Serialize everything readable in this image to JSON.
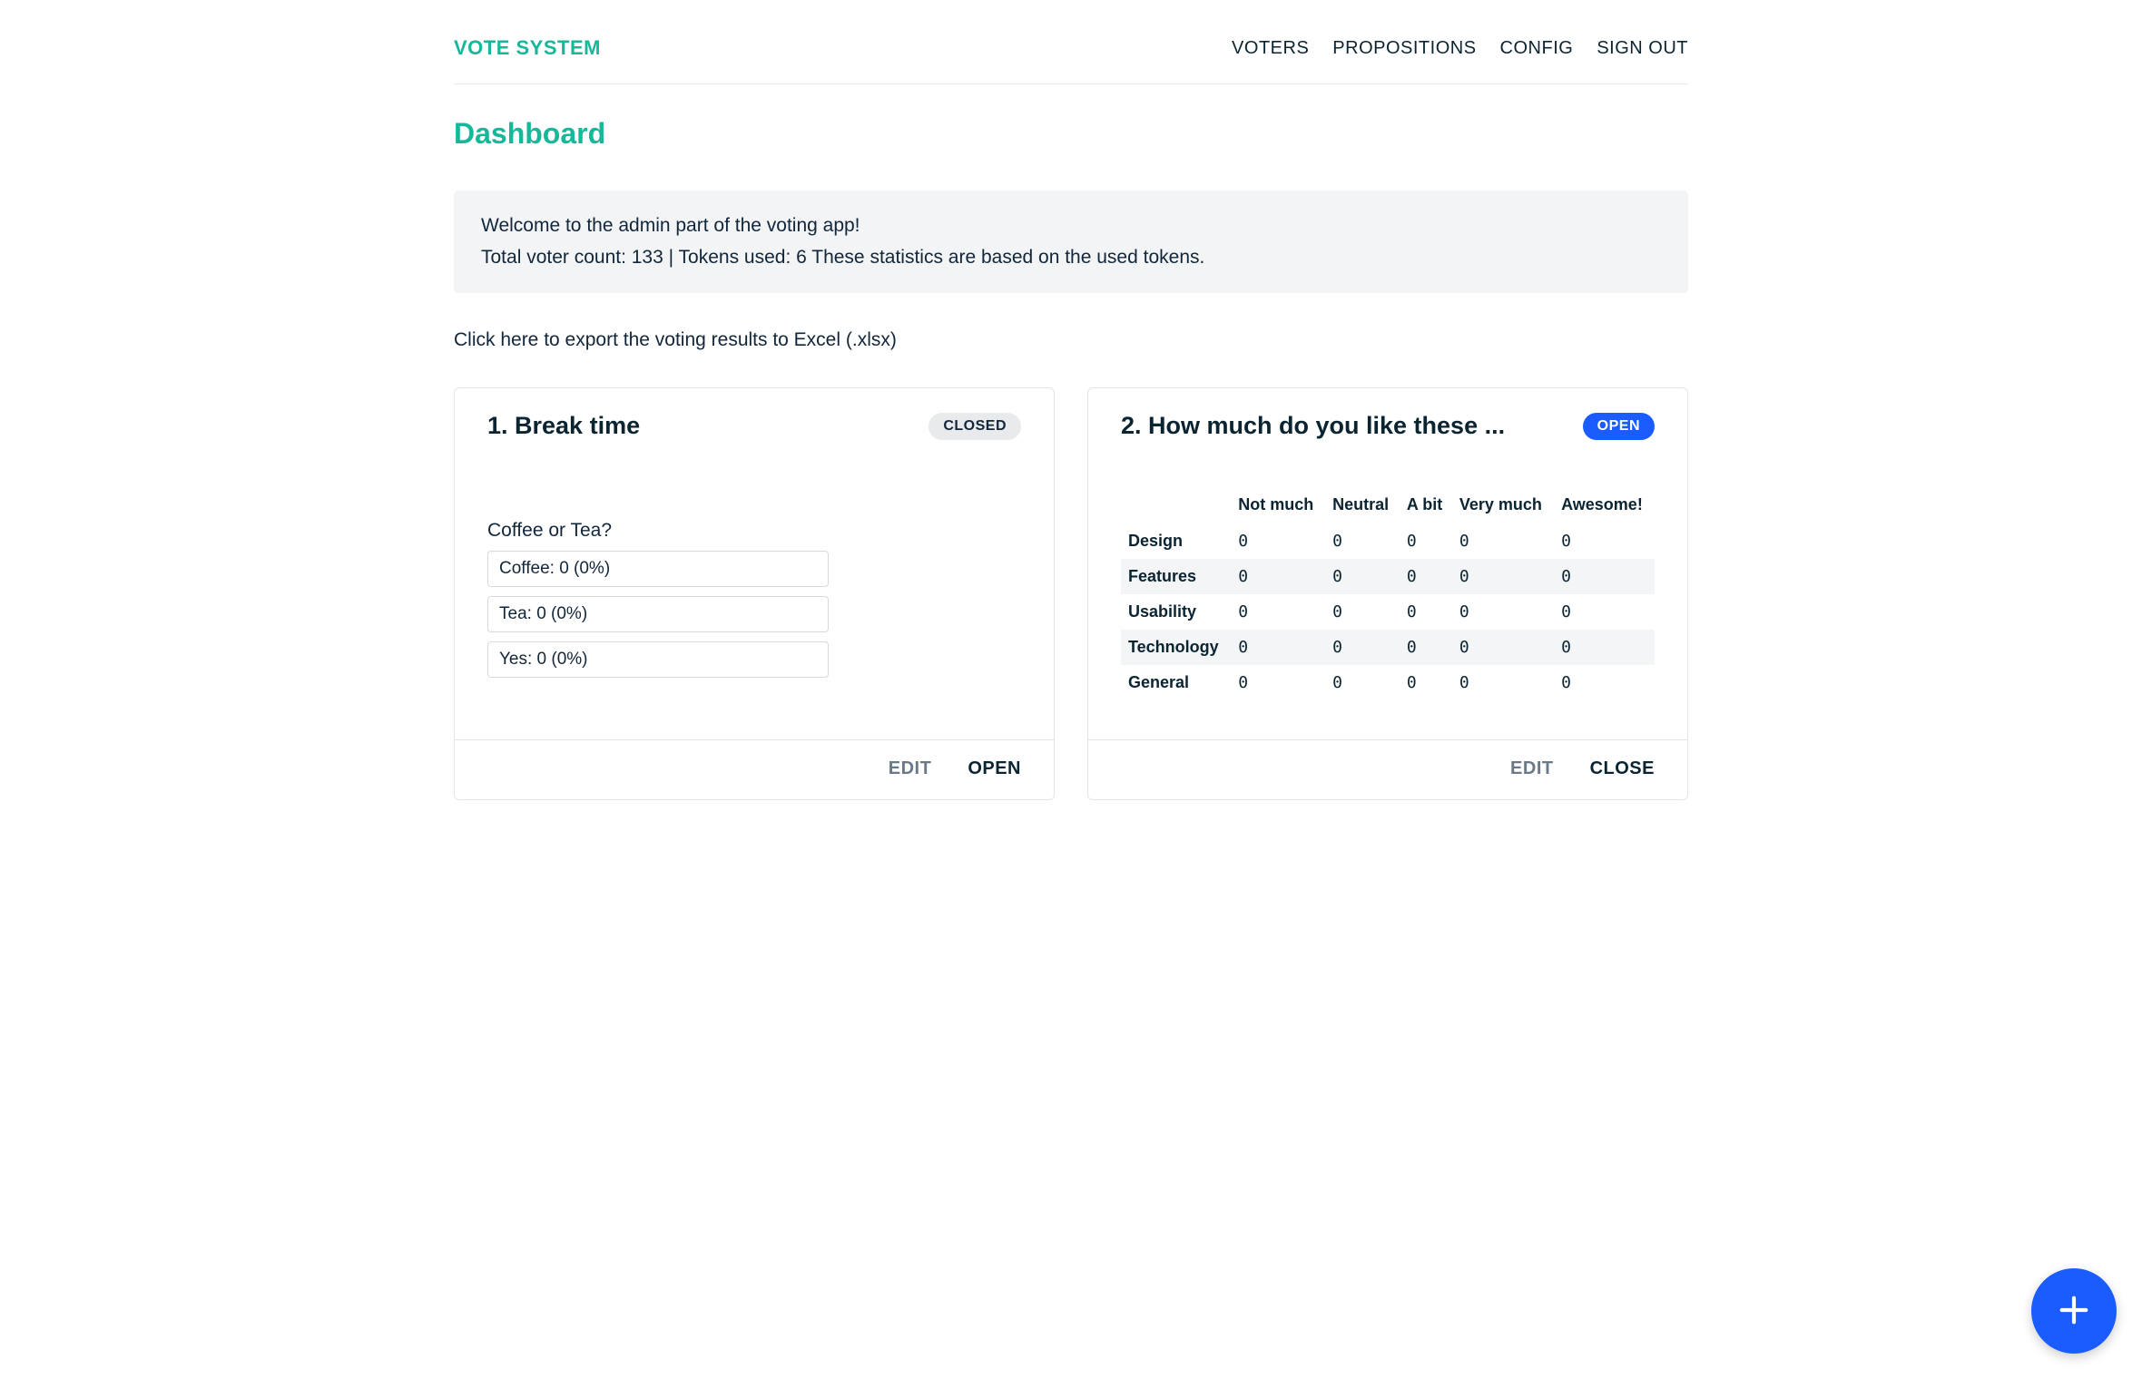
{
  "header": {
    "brand": "VOTE SYSTEM",
    "nav": [
      "VOTERS",
      "PROPOSITIONS",
      "CONFIG",
      "SIGN OUT"
    ]
  },
  "page_title": "Dashboard",
  "banner": {
    "line1": "Welcome to the admin part of the voting app!",
    "line2": "Total voter count: 133 | Tokens used: 6 These statistics are based on the used tokens."
  },
  "export_link": "Click here to export the voting results to Excel (.xlsx)",
  "status_labels": {
    "closed": "CLOSED",
    "open": "OPEN"
  },
  "action_labels": {
    "edit": "EDIT",
    "open": "OPEN",
    "close": "CLOSE"
  },
  "cards": [
    {
      "title": "1. Break time",
      "status": "closed",
      "question": "Coffee or Tea?",
      "options": [
        "Coffee: 0 (0%)",
        "Tea: 0 (0%)",
        "Yes: 0 (0%)"
      ],
      "actions": {
        "edit": "EDIT",
        "primary": "OPEN"
      }
    },
    {
      "title": "2. How much do you like these ...",
      "status": "open",
      "grid": {
        "columns": [
          "Not much",
          "Neutral",
          "A bit",
          "Very much",
          "Awesome!"
        ],
        "rows": [
          {
            "label": "Design",
            "values": [
              "0",
              "0",
              "0",
              "0",
              "0"
            ]
          },
          {
            "label": "Features",
            "values": [
              "0",
              "0",
              "0",
              "0",
              "0"
            ]
          },
          {
            "label": "Usability",
            "values": [
              "0",
              "0",
              "0",
              "0",
              "0"
            ]
          },
          {
            "label": "Technology",
            "values": [
              "0",
              "0",
              "0",
              "0",
              "0"
            ]
          },
          {
            "label": "General",
            "values": [
              "0",
              "0",
              "0",
              "0",
              "0"
            ]
          }
        ]
      },
      "actions": {
        "edit": "EDIT",
        "primary": "CLOSE"
      }
    }
  ]
}
